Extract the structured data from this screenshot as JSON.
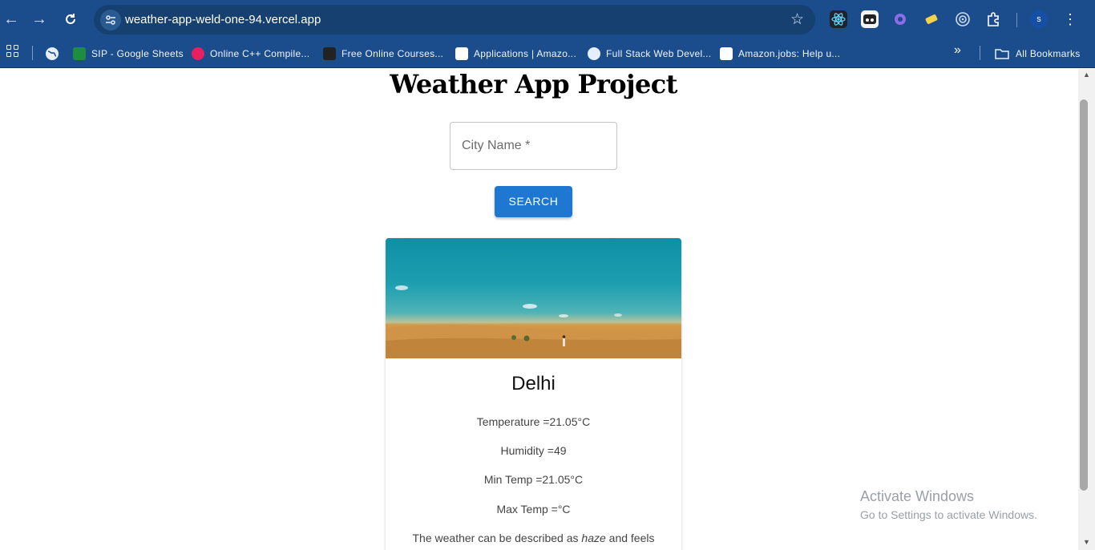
{
  "browser": {
    "url": "weather-app-weld-one-94.vercel.app",
    "icons": {
      "back": "back-arrow-icon",
      "forward": "forward-arrow-icon",
      "reload": "reload-icon",
      "site_info": "site-settings-icon",
      "bookmark_star": "star-icon",
      "extensions": "puzzle-icon",
      "menu": "more-vertical-icon"
    },
    "profile_initial": "s"
  },
  "bookmarks_bar": {
    "items": [
      {
        "label": "SIP - Google Sheets",
        "color": "#1e8e3e"
      },
      {
        "label": "Online C++ Compile...",
        "color": "#e91e63"
      },
      {
        "label": "Free Online Courses...",
        "color": "#222222"
      },
      {
        "label": "Applications | Amazo...",
        "color": "#ffffff"
      },
      {
        "label": "Full Stack Web Devel...",
        "color": "#e6eefb"
      },
      {
        "label": "Amazon.jobs: Help u...",
        "color": "#ffffff"
      }
    ],
    "all_bookmarks": "All Bookmarks"
  },
  "page": {
    "title": "Weather App Project",
    "search": {
      "label": "City Name *",
      "button": "SEARCH"
    },
    "weather": {
      "city": "Delhi",
      "temperature": "Temperature =21.05°C",
      "humidity": "Humidity =49",
      "min_temp": "Min Temp =21.05°C",
      "max_temp": "Max Temp =°C",
      "desc_prefix": "The weather can be described as ",
      "desc_condition": "haze",
      "desc_suffix": " and feels"
    }
  },
  "os_overlay": {
    "line1": "Activate Windows",
    "line2": "Go to Settings to activate Windows."
  },
  "colors": {
    "chrome": "#1b4d8c",
    "button": "#1e78d2"
  }
}
